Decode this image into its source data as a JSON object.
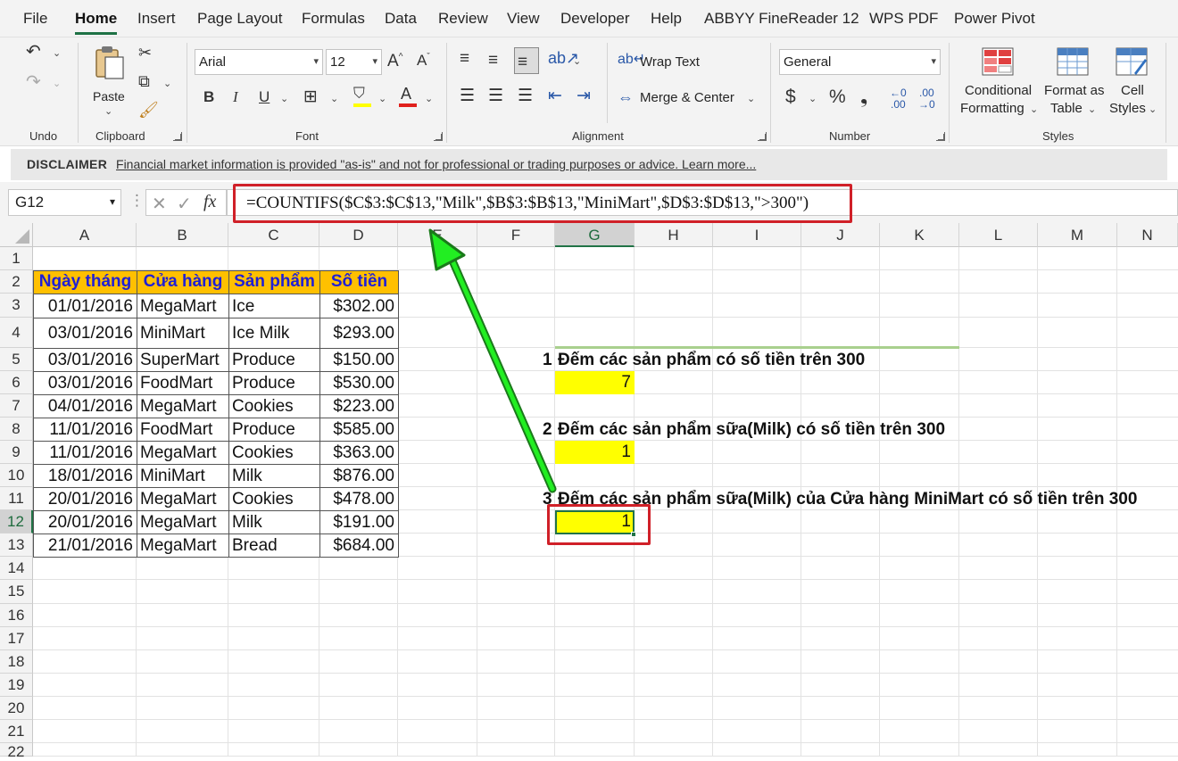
{
  "menu": {
    "tabs": [
      "File",
      "Home",
      "Insert",
      "Page Layout",
      "Formulas",
      "Data",
      "Review",
      "View",
      "Developer",
      "Help",
      "ABBYY FineReader 12",
      "WPS PDF",
      "Power Pivot"
    ],
    "active": "Home"
  },
  "ribbon": {
    "undo_group": "Undo",
    "clipboard": {
      "paste": "Paste",
      "group": "Clipboard"
    },
    "font": {
      "name": "Arial",
      "size": "12",
      "group": "Font",
      "bold": "B",
      "italic": "I",
      "underline": "U",
      "grow": "A^",
      "shrink": "Aˇ"
    },
    "alignment": {
      "wrap_text": "Wrap Text",
      "merge_center": "Merge & Center",
      "group": "Alignment"
    },
    "number": {
      "format": "General",
      "currency": "$",
      "percent": "%",
      "comma": "❟",
      "group": "Number"
    },
    "styles": {
      "conditional": [
        "Conditional",
        "Formatting"
      ],
      "format_table": [
        "Format as",
        "Table"
      ],
      "cell_styles": [
        "Cell",
        "Styles"
      ],
      "group": "Styles"
    }
  },
  "disclaimer": {
    "title": "DISCLAIMER",
    "text": "Financial market information is provided \"as-is\" and not for professional or trading purposes or advice. Learn more..."
  },
  "formula_bar": {
    "name_box": "G12",
    "fx": "fx",
    "formula": "=COUNTIFS($C$3:$C$13,\"Milk\",$B$3:$B$13,\"MiniMart\",$D$3:$D$13,\">300\")"
  },
  "columns": [
    "A",
    "B",
    "C",
    "D",
    "E",
    "F",
    "G",
    "H",
    "I",
    "J",
    "K",
    "L",
    "M",
    "N"
  ],
  "rows": [
    "1",
    "2",
    "3",
    "4",
    "5",
    "6",
    "7",
    "8",
    "9",
    "10",
    "11",
    "12",
    "13",
    "14",
    "15",
    "16",
    "17",
    "18",
    "19",
    "20",
    "21",
    "22"
  ],
  "selected_column": "G",
  "selected_row": "12",
  "table": {
    "headers": [
      "Ngày tháng",
      "Cửa hàng",
      "Sản phẩm",
      "Số tiền"
    ],
    "rows": [
      [
        "01/01/2016",
        "MegaMart",
        "Ice",
        "$302.00"
      ],
      [
        "03/01/2016",
        "MiniMart",
        "Ice Milk",
        "$293.00"
      ],
      [
        "03/01/2016",
        "SuperMart",
        "Produce",
        "$150.00"
      ],
      [
        "03/01/2016",
        "FoodMart",
        "Produce",
        "$530.00"
      ],
      [
        "04/01/2016",
        "MegaMart",
        "Cookies",
        "$223.00"
      ],
      [
        "11/01/2016",
        "FoodMart",
        "Produce",
        "$585.00"
      ],
      [
        "11/01/2016",
        "MegaMart",
        "Cookies",
        "$363.00"
      ],
      [
        "18/01/2016",
        "MiniMart",
        "Milk",
        "$876.00"
      ],
      [
        "20/01/2016",
        "MegaMart",
        "Cookies",
        "$478.00"
      ],
      [
        "20/01/2016",
        "MegaMart",
        "Milk",
        "$191.00"
      ],
      [
        "21/01/2016",
        "MegaMart",
        "Bread",
        "$684.00"
      ]
    ]
  },
  "questions": [
    {
      "num": "1",
      "text": "Đếm các sản phẩm có số tiền trên 300",
      "result": "7"
    },
    {
      "num": "2",
      "text": "Đếm các sản phẩm sữa(Milk) có số tiền trên 300",
      "result": "1"
    },
    {
      "num": "3",
      "text": "Đếm các sản phẩm sữa(Milk) của Cửa hàng MiniMart có số tiền trên 300",
      "result": "1"
    }
  ],
  "annotation_colors": {
    "highlight_box": "#d02028",
    "arrow": "#22dd22",
    "result_fill": "#ffff00",
    "header_fill": "#ffc000",
    "header_text": "#1f1fd6"
  }
}
